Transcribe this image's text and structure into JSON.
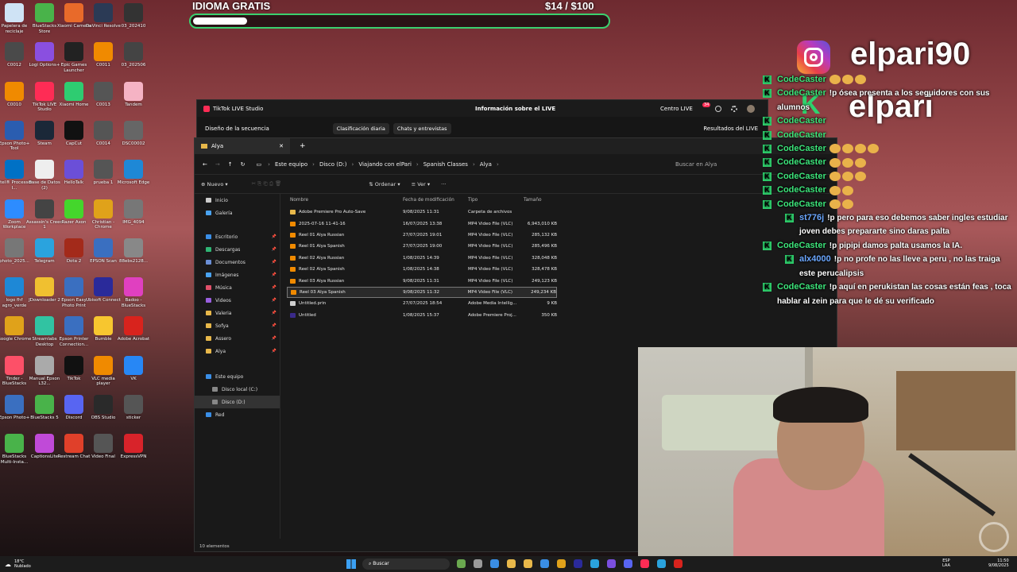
{
  "desktop_icons": [
    {
      "label": "Papelera de reciclaje",
      "icon": "recycle-bin-icon",
      "color": "#cfe3f5"
    },
    {
      "label": "BlueStacks Store",
      "icon": "bluestacks-icon",
      "color": "#49b34a"
    },
    {
      "label": "Xiaomi Camera",
      "icon": "camera-icon",
      "color": "#e86a2a"
    },
    {
      "label": "DaVinci Resolve",
      "icon": "resolve-icon",
      "color": "#2b3a55"
    },
    {
      "label": "03_202410",
      "icon": "video-thumb-icon",
      "color": "#333333"
    },
    {
      "label": "C0012",
      "icon": "video-thumb-icon",
      "color": "#4a4a4a"
    },
    {
      "label": "Logi Options+",
      "icon": "logi-icon",
      "color": "#8a4fe0"
    },
    {
      "label": "Epic Games Launcher",
      "icon": "epic-icon",
      "color": "#222222"
    },
    {
      "label": "C0011",
      "icon": "vlc-icon",
      "color": "#f08a00"
    },
    {
      "label": "03_202506",
      "icon": "video-thumb-icon",
      "color": "#444444"
    },
    {
      "label": "C0010",
      "icon": "vlc-icon",
      "color": "#f08a00"
    },
    {
      "label": "TikTok LIVE Studio",
      "icon": "tiktok-icon",
      "color": "#fe2c55"
    },
    {
      "label": "Xiaomi Home",
      "icon": "home-icon",
      "color": "#2ecc71"
    },
    {
      "label": "C0013",
      "icon": "video-thumb-icon",
      "color": "#555555"
    },
    {
      "label": "Tandem",
      "icon": "tandem-icon",
      "color": "#f5b3c4"
    },
    {
      "label": "Epson Photo+ Tool",
      "icon": "epson-icon",
      "color": "#2a5db0"
    },
    {
      "label": "Steam",
      "icon": "steam-icon",
      "color": "#1b2838"
    },
    {
      "label": "CapCut",
      "icon": "capcut-icon",
      "color": "#111111"
    },
    {
      "label": "C0014",
      "icon": "video-thumb-icon",
      "color": "#555555"
    },
    {
      "label": "DSC00002",
      "icon": "image-thumb-icon",
      "color": "#666666"
    },
    {
      "label": "Intel® Processor I...",
      "icon": "intel-icon",
      "color": "#0071c5"
    },
    {
      "label": "Base de Datos (2)",
      "icon": "document-icon",
      "color": "#eeeeee"
    },
    {
      "label": "HelloTalk",
      "icon": "hellotalk-icon",
      "color": "#6b4fd8"
    },
    {
      "label": "prueba 1",
      "icon": "video-thumb-icon",
      "color": "#555555"
    },
    {
      "label": "Microsoft Edge",
      "icon": "edge-icon",
      "color": "#1e88d6"
    },
    {
      "label": "Zoom Workplace",
      "icon": "zoom-icon",
      "color": "#2d8cff"
    },
    {
      "label": "Assassin's Creed 1",
      "icon": "game-icon",
      "color": "#444444"
    },
    {
      "label": "Razer Axon",
      "icon": "razer-icon",
      "color": "#44d62c"
    },
    {
      "label": "Christian - Chrome",
      "icon": "chrome-icon",
      "color": "#e0a21a"
    },
    {
      "label": "IMG_4094",
      "icon": "image-thumb-icon",
      "color": "#777777"
    },
    {
      "label": "photo_2025...",
      "icon": "image-thumb-icon",
      "color": "#777777"
    },
    {
      "label": "Telegram",
      "icon": "telegram-icon",
      "color": "#2aa3de"
    },
    {
      "label": "Dota 2",
      "icon": "dota-icon",
      "color": "#a32a1a"
    },
    {
      "label": "EPSON Scan",
      "icon": "scan-icon",
      "color": "#3a6fc0"
    },
    {
      "label": "88ebs2128...",
      "icon": "image-thumb-icon",
      "color": "#888888"
    },
    {
      "label": "logo fhf agro_verde",
      "icon": "edge-icon",
      "color": "#1e88d6"
    },
    {
      "label": "JDownloader 2",
      "icon": "jdownloader-icon",
      "color": "#f0c030"
    },
    {
      "label": "Epson Easy Photo Print",
      "icon": "epson-icon",
      "color": "#3a6fc0"
    },
    {
      "label": "Ubisoft Connect",
      "icon": "ubisoft-icon",
      "color": "#2a2a9a"
    },
    {
      "label": "Badoo - BlueStacks",
      "icon": "badoo-icon",
      "color": "#e040c0"
    },
    {
      "label": "Google Chrome",
      "icon": "chrome-icon",
      "color": "#e0a21a"
    },
    {
      "label": "Streamlabs Desktop",
      "icon": "streamlabs-icon",
      "color": "#31c3a2"
    },
    {
      "label": "Epson Printer Connection...",
      "icon": "epson-icon",
      "color": "#3a6fc0"
    },
    {
      "label": "Bumble",
      "icon": "bumble-icon",
      "color": "#f7c62f"
    },
    {
      "label": "Adobe Acrobat",
      "icon": "acrobat-icon",
      "color": "#d8231d"
    },
    {
      "label": "Tinder - BlueStacks",
      "icon": "tinder-icon",
      "color": "#fd5068"
    },
    {
      "label": "Manual Epson L32...",
      "icon": "manual-icon",
      "color": "#aaaaaa"
    },
    {
      "label": "TikTok",
      "icon": "tiktok-icon",
      "color": "#111111"
    },
    {
      "label": "VLC media player",
      "icon": "vlc-icon",
      "color": "#f08a00"
    },
    {
      "label": "VK",
      "icon": "vk-icon",
      "color": "#2787f5"
    },
    {
      "label": "Epson Photo+",
      "icon": "epson-icon",
      "color": "#3a6fc0"
    },
    {
      "label": "BlueStacks 5",
      "icon": "bluestacks-icon",
      "color": "#49b34a"
    },
    {
      "label": "Discord",
      "icon": "discord-icon",
      "color": "#5865f2"
    },
    {
      "label": "OBS Studio",
      "icon": "obs-icon",
      "color": "#2a2a2a"
    },
    {
      "label": "sticker",
      "icon": "image-thumb-icon",
      "color": "#555555"
    },
    {
      "label": "BlueStacks Multi-Insta...",
      "icon": "bluestacks-icon",
      "color": "#49b34a"
    },
    {
      "label": "CaptionsLite",
      "icon": "captions-icon",
      "color": "#c04ad8"
    },
    {
      "label": "Restream Chat",
      "icon": "restream-icon",
      "color": "#e0402a"
    },
    {
      "label": "Video Final",
      "icon": "video-thumb-icon",
      "color": "#555555"
    },
    {
      "label": "ExpressVPN",
      "icon": "vpn-icon",
      "color": "#d8232a"
    }
  ],
  "goal": {
    "title": "IDIOMA GRATIS",
    "amount": "$14  / $100",
    "progress": 0.14
  },
  "overlay": {
    "brand": "elpari90",
    "brand2": "elpari"
  },
  "tiktok_studio": {
    "title": "TikTok LIVE Studio",
    "center": "Información sobre el LIVE",
    "centro": "Centro LIVE",
    "notif": "34",
    "seq": "Diseño de la secuencia",
    "tab1": "Clasificación diaria",
    "tab2": "Chats y entrevistas",
    "results": "Resultados del LIVE"
  },
  "explorer": {
    "tab": "Alya",
    "breadcrumb": [
      "Este equipo",
      "Disco (D:)",
      "Viajando con elPari",
      "Spanish Classes",
      "Alya"
    ],
    "search_placeholder": "Buscar en Alya",
    "new": "Nuevo",
    "sort": "Ordenar",
    "view": "Ver",
    "nav_top": [
      {
        "label": "Inicio",
        "color": "#ccc"
      },
      {
        "label": "Galería",
        "color": "#4aa3f0"
      }
    ],
    "nav_quick": [
      {
        "label": "Escritorio",
        "color": "#3a8ee6"
      },
      {
        "label": "Descargas",
        "color": "#2fb574"
      },
      {
        "label": "Documentos",
        "color": "#6b8fd6"
      },
      {
        "label": "Imágenes",
        "color": "#4aa3f0"
      },
      {
        "label": "Música",
        "color": "#e0506a"
      },
      {
        "label": "Videos",
        "color": "#9a5fe0"
      },
      {
        "label": "Valeria",
        "color": "#e8b84a"
      },
      {
        "label": "Sofya",
        "color": "#e8b84a"
      },
      {
        "label": "Assero",
        "color": "#e8b84a"
      },
      {
        "label": "Alya",
        "color": "#e8b84a"
      }
    ],
    "nav_pc": {
      "label": "Este equipo",
      "drives": [
        "Disco local (C:)",
        "Disco (D:)"
      ],
      "net": "Red"
    },
    "columns": [
      "Nombre",
      "Fecha de modificación",
      "Tipo",
      "Tamaño"
    ],
    "files": [
      {
        "name": "Adobe Premiere Pro Auto-Save",
        "date": "9/08/2025 11:31",
        "type": "Carpeta de archivos",
        "size": "",
        "kind": "folder"
      },
      {
        "name": "2025-07-16 11-41-16",
        "date": "16/07/2025 13:38",
        "type": "MP4 Video File (VLC)",
        "size": "6,943,010 KB",
        "kind": "vlc"
      },
      {
        "name": "Reel 01 Alya Russian",
        "date": "27/07/2025 19:01",
        "type": "MP4 Video File (VLC)",
        "size": "285,132 KB",
        "kind": "vlc"
      },
      {
        "name": "Reel 01 Alya Spanish",
        "date": "27/07/2025 19:00",
        "type": "MP4 Video File (VLC)",
        "size": "285,496 KB",
        "kind": "vlc"
      },
      {
        "name": "Reel 02 Alya Russian",
        "date": "1/08/2025 14:39",
        "type": "MP4 Video File (VLC)",
        "size": "328,048 KB",
        "kind": "vlc"
      },
      {
        "name": "Reel 02 Alya Spanish",
        "date": "1/08/2025 14:38",
        "type": "MP4 Video File (VLC)",
        "size": "328,478 KB",
        "kind": "vlc"
      },
      {
        "name": "Reel 03 Alya Russian",
        "date": "9/08/2025 11:31",
        "type": "MP4 Video File (VLC)",
        "size": "249,123 KB",
        "kind": "vlc"
      },
      {
        "name": "Reel 03 Alya Spanish",
        "date": "9/08/2025 11:32",
        "type": "MP4 Video File (VLC)",
        "size": "249,234 KB",
        "kind": "vlc",
        "selected": true
      },
      {
        "name": "Untitled.prin",
        "date": "27/07/2025 18:54",
        "type": "Adobe Media Intellig...",
        "size": "9 KB",
        "kind": "doc"
      },
      {
        "name": "Untitled",
        "date": "1/08/2025 15:37",
        "type": "Adobe Premiere Proj...",
        "size": "350 KB",
        "kind": "pr"
      }
    ],
    "status": "10 elementos"
  },
  "chat": [
    {
      "user": "CodeCaster",
      "msg": "",
      "ind": false,
      "emotes": 3
    },
    {
      "user": "CodeCaster",
      "msg": "!p ósea presenta a los seguidores con sus alumnos",
      "ind": false
    },
    {
      "user": "CodeCaster",
      "msg": "",
      "ind": false,
      "emotes": 0
    },
    {
      "user": "CodeCaster",
      "msg": "",
      "ind": false,
      "emotes": 0
    },
    {
      "user": "CodeCaster",
      "msg": "",
      "ind": false,
      "emotes": 4
    },
    {
      "user": "CodeCaster",
      "msg": "",
      "ind": false,
      "emotes": 3
    },
    {
      "user": "CodeCaster",
      "msg": "",
      "ind": false,
      "emotes": 3
    },
    {
      "user": "CodeCaster",
      "msg": "",
      "ind": false,
      "emotes": 2
    },
    {
      "user": "CodeCaster",
      "msg": "",
      "ind": false,
      "emotes": 2
    },
    {
      "user": "st776j",
      "msg": "!p pero para eso debemos saber ingles estudiar joven debes prepararte sino daras palta",
      "ind": true,
      "blue": true
    },
    {
      "user": "CodeCaster",
      "msg": "!p pipipi damos palta usamos la IA.",
      "ind": false
    },
    {
      "user": "alx4000",
      "msg": "!p no profe no las lleve a peru , no las traiga este perucalipsis",
      "ind": true,
      "blue": true
    },
    {
      "user": "CodeCaster",
      "msg": "!p aquí en perukistan las cosas están feas , toca hablar al zein para que le dé su verificado",
      "ind": false
    }
  ],
  "taskbar": {
    "weather": "18°C",
    "weather2": "Nublado",
    "search": "Buscar",
    "lang": "ESP",
    "lang2": "LAA",
    "time": "11:50",
    "date": "9/08/2025"
  }
}
